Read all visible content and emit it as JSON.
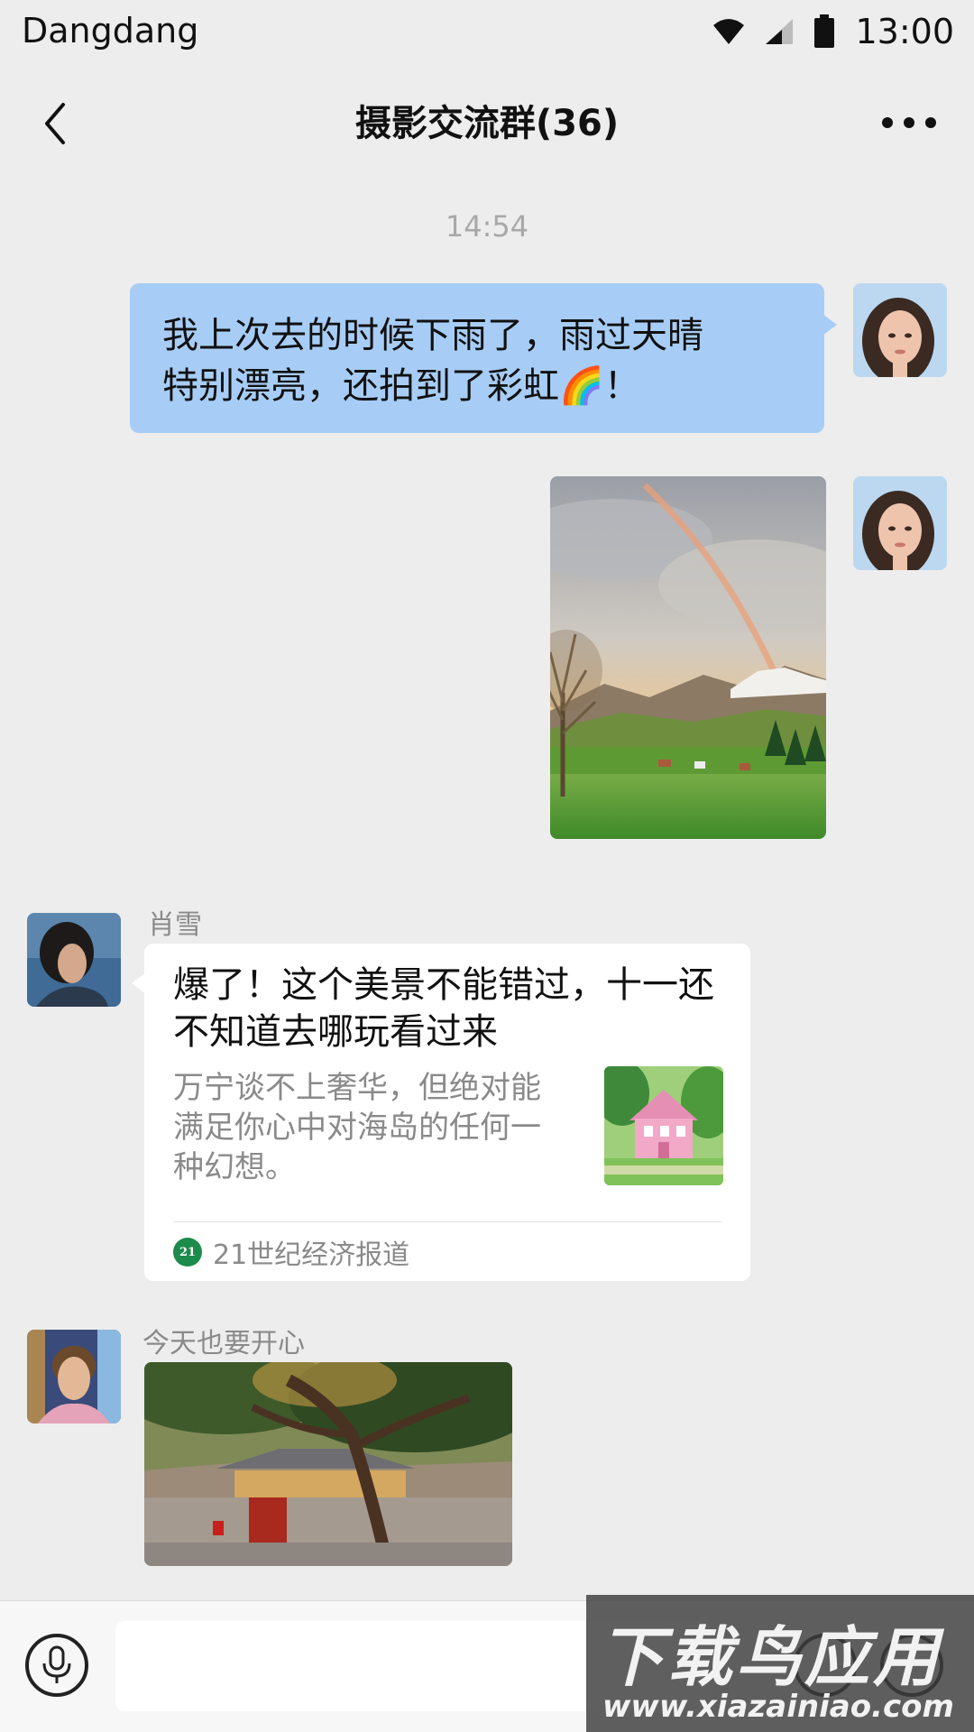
{
  "status_bar": {
    "carrier": "Dangdang",
    "time": "13:00",
    "icons": [
      "wifi-icon",
      "cellular-signal-icon",
      "battery-icon"
    ]
  },
  "nav": {
    "title": "摄影交流群(36)",
    "back_icon": "chevron-left-icon",
    "more_icon": "more-dots-icon"
  },
  "timestamp": "14:54",
  "messages": [
    {
      "type": "text",
      "side": "right",
      "bubble_color": "#a7cdf6",
      "text_line1": "我上次去的时候下雨了，雨过天晴",
      "text_line2": "特别漂亮，还拍到了彩虹🌈！"
    },
    {
      "type": "image",
      "side": "right",
      "image": "rainbow-mountain-meadow-photo"
    },
    {
      "type": "link-card",
      "side": "left",
      "sender": "肖雪",
      "title": "爆了！这个美景不能错过，十一还不知道去哪玩看过来",
      "description": "万宁谈不上奢华，但绝对能满足你心中对海岛的任何一种幻想。",
      "thumbnail": "pink-house-thumbnail",
      "source_logo_text": "21",
      "source_name": "21世纪经济报道"
    },
    {
      "type": "image",
      "side": "left",
      "sender": "今天也要开心",
      "image": "courtyard-tree-sunset-photo"
    }
  ],
  "input_bar": {
    "voice_icon": "microphone-icon",
    "emoji_icon": "emoji-icon",
    "plus_icon": "plus-icon"
  },
  "watermark": {
    "title": "下载鸟应用",
    "url": "www.xiazainiao.com"
  }
}
